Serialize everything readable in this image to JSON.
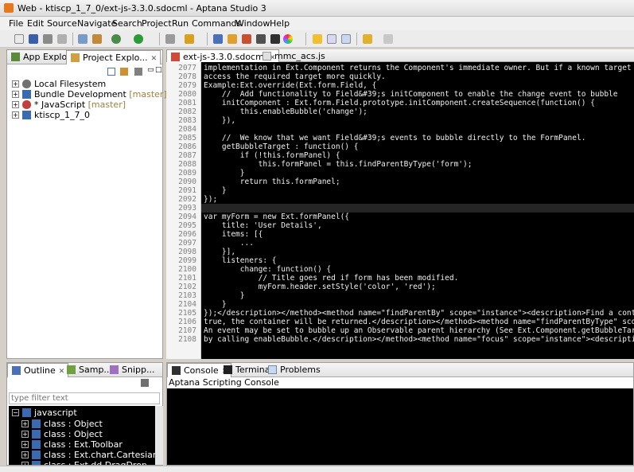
{
  "window": {
    "title": "Web - ktiscp_1_7_0/ext-js-3.3.0.sdocml - Aptana Studio 3"
  },
  "menu": [
    "File",
    "Edit",
    "Source",
    "Navigate",
    "Search",
    "Project",
    "Run",
    "Commands",
    "Window",
    "Help"
  ],
  "left_top": {
    "tabs": [
      {
        "label": "App Explorer"
      },
      {
        "label": "Project Explo..."
      }
    ],
    "tree": [
      {
        "label": "Local Filesystem",
        "suffix": ""
      },
      {
        "label": "Bundle Development",
        "suffix": " [master]"
      },
      {
        "label": "* JavaScript",
        "suffix": " [master]"
      },
      {
        "label": "ktiscp_1_7_0",
        "suffix": ""
      }
    ]
  },
  "editor": {
    "tabs": [
      {
        "label": "ext-js-3.3.0.sdocml"
      },
      {
        "label": "mmc_acs.js"
      }
    ],
    "lines": [
      {
        "n": "2077",
        "t": "implementation in Ext.Component returns the Component's immediate owner. But if a known target is required"
      },
      {
        "n": "2078",
        "t": "access the required target more quickly."
      },
      {
        "n": "2079",
        "t": "Example:Ext.override(Ext.form.Field, {"
      },
      {
        "n": "2080",
        "t": "    //  Add functionality to Field&#39;s initComponent to enable the change event to bubble"
      },
      {
        "n": "2081",
        "t": "    initComponent : Ext.form.Field.prototype.initComponent.createSequence(function() {"
      },
      {
        "n": "2082",
        "t": "        this.enableBubble('change');"
      },
      {
        "n": "2083",
        "t": "    }),"
      },
      {
        "n": "2084",
        "t": ""
      },
      {
        "n": "2085",
        "t": "    //  We know that we want Field&#39;s events to bubble directly to the FormPanel."
      },
      {
        "n": "2086",
        "t": "    getBubbleTarget : function() {"
      },
      {
        "n": "2087",
        "t": "        if (!this.formPanel) {"
      },
      {
        "n": "2088",
        "t": "            this.formPanel = this.findParentByType('form');"
      },
      {
        "n": "2089",
        "t": "        }"
      },
      {
        "n": "2090",
        "t": "        return this.formPanel;"
      },
      {
        "n": "2091",
        "t": "    }"
      },
      {
        "n": "2092",
        "t": "});"
      },
      {
        "n": "2093",
        "t": ""
      },
      {
        "n": "2094",
        "t": "var myForm = new Ext.formPanel({"
      },
      {
        "n": "2095",
        "t": "    title: 'User Details',"
      },
      {
        "n": "2096",
        "t": "    items: [{"
      },
      {
        "n": "2097",
        "t": "        ..."
      },
      {
        "n": "2098",
        "t": "    }],"
      },
      {
        "n": "2099",
        "t": "    listeners: {"
      },
      {
        "n": "2100",
        "t": "        change: function() {"
      },
      {
        "n": "2101",
        "t": "            // Title goes red if form has been modified."
      },
      {
        "n": "2102",
        "t": "            myForm.header.setStyle('color', 'red');"
      },
      {
        "n": "2103",
        "t": "        }"
      },
      {
        "n": "2104",
        "t": "    }"
      },
      {
        "n": "2105",
        "t": "});</description></method><method name=\"findParentBy\" scope=\"instance\"><description>Find a container above"
      },
      {
        "n": "2106",
        "t": "true, the container will be returned.</description></method><method name=\"findParentByType\" scope=\"instance\""
      },
      {
        "n": "2107",
        "t": "An event may be set to bubble up an Observable parent hierarchy (See Ext.Component.getBubbleTarget)"
      },
      {
        "n": "2108",
        "t": "by calling enableBubble.</description></method><method name=\"focus\" scope=\"instance\"><description>Try to f"
      }
    ]
  },
  "left_bottom": {
    "tabs": [
      {
        "label": "Outline"
      },
      {
        "label": "Samp..."
      },
      {
        "label": "Snipp..."
      }
    ],
    "filter_placeholder": "type filter text",
    "tree_root": "javascript",
    "items": [
      "class : Object",
      "class : Object",
      "class : Ext.Toolbar",
      "class : Ext.chart.CartesianChart",
      "class : Ext.dd.DragDrop"
    ]
  },
  "console": {
    "tabs": [
      {
        "label": "Console"
      },
      {
        "label": "Terminal"
      },
      {
        "label": "Problems"
      }
    ],
    "title": "Aptana Scripting Console"
  }
}
